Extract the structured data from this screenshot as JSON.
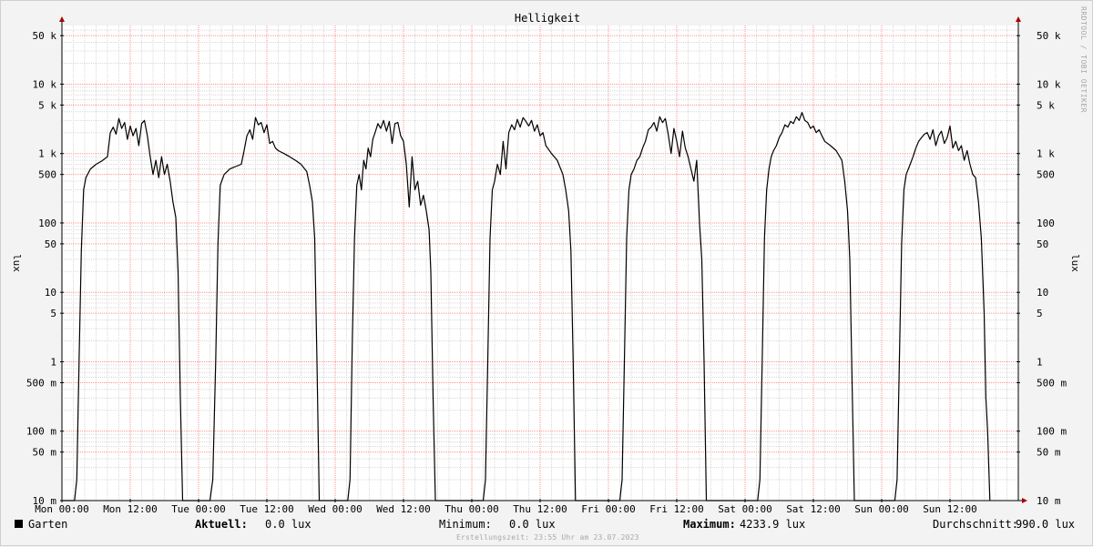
{
  "chart_data": {
    "type": "line",
    "title": "Helligkeit",
    "ylabel": "lux",
    "ylabel_right": "lux",
    "yscale": "log",
    "ylim": [
      0.01,
      70000
    ],
    "y_ticks": [
      {
        "value": 50000,
        "label": "50 k"
      },
      {
        "value": 10000,
        "label": "10 k"
      },
      {
        "value": 5000,
        "label": "5 k"
      },
      {
        "value": 1000,
        "label": "1 k"
      },
      {
        "value": 500,
        "label": "500"
      },
      {
        "value": 100,
        "label": "100"
      },
      {
        "value": 50,
        "label": "50"
      },
      {
        "value": 10,
        "label": "10"
      },
      {
        "value": 5,
        "label": "5"
      },
      {
        "value": 1,
        "label": "1"
      },
      {
        "value": 0.5,
        "label": "500 m"
      },
      {
        "value": 0.1,
        "label": "100 m"
      },
      {
        "value": 0.05,
        "label": "50 m"
      },
      {
        "value": 0.01,
        "label": "10 m"
      }
    ],
    "x_ticks": [
      "Mon 00:00",
      "Mon 12:00",
      "Tue 00:00",
      "Tue 12:00",
      "Wed 00:00",
      "Wed 12:00",
      "Thu 00:00",
      "Thu 12:00",
      "Fri 00:00",
      "Fri 12:00",
      "Sat 00:00",
      "Sat 12:00",
      "Sun 00:00",
      "Sun 12:00"
    ],
    "x_unit": "hours since Mon 00:00",
    "xlim": [
      0,
      168
    ],
    "grid": true,
    "series": [
      {
        "name": "Garten",
        "color": "#000000",
        "points": [
          [
            0,
            0.01
          ],
          [
            2.2,
            0.01
          ],
          [
            2.6,
            0.02
          ],
          [
            3.0,
            1
          ],
          [
            3.4,
            40
          ],
          [
            3.8,
            300
          ],
          [
            4.2,
            450
          ],
          [
            5.0,
            600
          ],
          [
            6.0,
            700
          ],
          [
            7.0,
            780
          ],
          [
            8.0,
            900
          ],
          [
            8.5,
            2000
          ],
          [
            9.0,
            2400
          ],
          [
            9.5,
            1900
          ],
          [
            10.0,
            3200
          ],
          [
            10.5,
            2300
          ],
          [
            11.0,
            2800
          ],
          [
            11.5,
            1600
          ],
          [
            12.0,
            2500
          ],
          [
            12.5,
            1800
          ],
          [
            13.0,
            2300
          ],
          [
            13.5,
            1300
          ],
          [
            14.0,
            2700
          ],
          [
            14.5,
            3000
          ],
          [
            15.0,
            1800
          ],
          [
            15.5,
            900
          ],
          [
            16.0,
            500
          ],
          [
            16.5,
            800
          ],
          [
            17.0,
            450
          ],
          [
            17.5,
            900
          ],
          [
            18.0,
            500
          ],
          [
            18.5,
            700
          ],
          [
            19.0,
            400
          ],
          [
            19.5,
            200
          ],
          [
            20.0,
            120
          ],
          [
            20.4,
            20
          ],
          [
            20.8,
            0.3
          ],
          [
            21.2,
            0.01
          ],
          [
            24,
            0.01
          ],
          [
            26.0,
            0.01
          ],
          [
            26.5,
            0.02
          ],
          [
            27.0,
            1
          ],
          [
            27.4,
            50
          ],
          [
            27.8,
            350
          ],
          [
            28.5,
            500
          ],
          [
            29.5,
            600
          ],
          [
            30.5,
            650
          ],
          [
            31.5,
            700
          ],
          [
            32.0,
            1100
          ],
          [
            32.5,
            1800
          ],
          [
            33.0,
            2200
          ],
          [
            33.5,
            1600
          ],
          [
            34.0,
            3300
          ],
          [
            34.5,
            2600
          ],
          [
            35.0,
            2800
          ],
          [
            35.5,
            2000
          ],
          [
            36.0,
            2600
          ],
          [
            36.5,
            1400
          ],
          [
            37.0,
            1500
          ],
          [
            37.5,
            1200
          ],
          [
            38.0,
            1100
          ],
          [
            39.0,
            1000
          ],
          [
            40.0,
            900
          ],
          [
            41.0,
            800
          ],
          [
            42.0,
            700
          ],
          [
            43.0,
            550
          ],
          [
            43.5,
            350
          ],
          [
            44.0,
            200
          ],
          [
            44.4,
            60
          ],
          [
            44.8,
            1
          ],
          [
            45.2,
            0.01
          ],
          [
            48,
            0.01
          ],
          [
            50.2,
            0.01
          ],
          [
            50.6,
            0.02
          ],
          [
            51.0,
            2
          ],
          [
            51.4,
            60
          ],
          [
            51.8,
            350
          ],
          [
            52.2,
            500
          ],
          [
            52.6,
            300
          ],
          [
            53.0,
            800
          ],
          [
            53.4,
            600
          ],
          [
            53.8,
            1200
          ],
          [
            54.2,
            900
          ],
          [
            54.6,
            1600
          ],
          [
            55.0,
            2000
          ],
          [
            55.5,
            2700
          ],
          [
            56.0,
            2300
          ],
          [
            56.5,
            3000
          ],
          [
            57.0,
            2100
          ],
          [
            57.5,
            2900
          ],
          [
            58.0,
            1400
          ],
          [
            58.5,
            2700
          ],
          [
            59.0,
            2800
          ],
          [
            59.5,
            1800
          ],
          [
            60.0,
            1500
          ],
          [
            60.5,
            700
          ],
          [
            61.0,
            170
          ],
          [
            61.5,
            900
          ],
          [
            62.0,
            300
          ],
          [
            62.5,
            400
          ],
          [
            63.0,
            180
          ],
          [
            63.5,
            250
          ],
          [
            64.0,
            150
          ],
          [
            64.5,
            80
          ],
          [
            64.8,
            20
          ],
          [
            65.2,
            0.3
          ],
          [
            65.6,
            0.01
          ],
          [
            72,
            0.01
          ],
          [
            74.0,
            0.01
          ],
          [
            74.4,
            0.02
          ],
          [
            74.8,
            1
          ],
          [
            75.2,
            60
          ],
          [
            75.6,
            300
          ],
          [
            76.0,
            400
          ],
          [
            76.5,
            700
          ],
          [
            77.0,
            500
          ],
          [
            77.5,
            1500
          ],
          [
            78.0,
            600
          ],
          [
            78.5,
            2000
          ],
          [
            79.0,
            2600
          ],
          [
            79.5,
            2200
          ],
          [
            80.0,
            3100
          ],
          [
            80.5,
            2400
          ],
          [
            81.0,
            3300
          ],
          [
            81.5,
            2900
          ],
          [
            82.0,
            2500
          ],
          [
            82.5,
            3000
          ],
          [
            83.0,
            2100
          ],
          [
            83.5,
            2600
          ],
          [
            84.0,
            1800
          ],
          [
            84.5,
            2000
          ],
          [
            85.0,
            1300
          ],
          [
            86.0,
            1000
          ],
          [
            87.0,
            800
          ],
          [
            88.0,
            500
          ],
          [
            88.5,
            300
          ],
          [
            89.0,
            150
          ],
          [
            89.4,
            40
          ],
          [
            89.8,
            1
          ],
          [
            90.2,
            0.01
          ],
          [
            96,
            0.01
          ],
          [
            98.0,
            0.01
          ],
          [
            98.4,
            0.02
          ],
          [
            98.8,
            1
          ],
          [
            99.2,
            60
          ],
          [
            99.6,
            300
          ],
          [
            100.0,
            500
          ],
          [
            100.5,
            600
          ],
          [
            101.0,
            800
          ],
          [
            101.5,
            900
          ],
          [
            102.0,
            1200
          ],
          [
            102.5,
            1500
          ],
          [
            103.0,
            2200
          ],
          [
            103.5,
            2400
          ],
          [
            104.0,
            2800
          ],
          [
            104.5,
            2100
          ],
          [
            105.0,
            3400
          ],
          [
            105.5,
            2800
          ],
          [
            106.0,
            3200
          ],
          [
            106.5,
            1900
          ],
          [
            107.0,
            1000
          ],
          [
            107.5,
            2300
          ],
          [
            108.0,
            1500
          ],
          [
            108.5,
            900
          ],
          [
            109.0,
            2100
          ],
          [
            109.5,
            1200
          ],
          [
            110.0,
            900
          ],
          [
            110.5,
            600
          ],
          [
            111.0,
            400
          ],
          [
            111.5,
            800
          ],
          [
            112.0,
            100
          ],
          [
            112.4,
            30
          ],
          [
            112.8,
            1
          ],
          [
            113.2,
            0.01
          ],
          [
            120,
            0.01
          ],
          [
            122.2,
            0.01
          ],
          [
            122.6,
            0.02
          ],
          [
            123.0,
            1
          ],
          [
            123.4,
            60
          ],
          [
            123.8,
            300
          ],
          [
            124.2,
            600
          ],
          [
            124.6,
            900
          ],
          [
            125.0,
            1100
          ],
          [
            125.5,
            1300
          ],
          [
            126.0,
            1700
          ],
          [
            126.5,
            2000
          ],
          [
            127.0,
            2600
          ],
          [
            127.5,
            2400
          ],
          [
            128.0,
            2900
          ],
          [
            128.5,
            2700
          ],
          [
            129.0,
            3400
          ],
          [
            129.5,
            3000
          ],
          [
            130.0,
            3900
          ],
          [
            130.5,
            3000
          ],
          [
            131.0,
            2800
          ],
          [
            131.5,
            2300
          ],
          [
            132.0,
            2500
          ],
          [
            132.5,
            2000
          ],
          [
            133.0,
            2200
          ],
          [
            133.5,
            1800
          ],
          [
            134.0,
            1500
          ],
          [
            135.0,
            1300
          ],
          [
            136.0,
            1100
          ],
          [
            137.0,
            800
          ],
          [
            137.5,
            400
          ],
          [
            138.0,
            150
          ],
          [
            138.4,
            30
          ],
          [
            138.8,
            0.5
          ],
          [
            139.2,
            0.01
          ],
          [
            144,
            0.01
          ],
          [
            146.3,
            0.01
          ],
          [
            146.7,
            0.02
          ],
          [
            147.1,
            1
          ],
          [
            147.5,
            50
          ],
          [
            147.9,
            300
          ],
          [
            148.3,
            500
          ],
          [
            149.0,
            700
          ],
          [
            149.5,
            900
          ],
          [
            150.0,
            1200
          ],
          [
            150.5,
            1500
          ],
          [
            151.0,
            1700
          ],
          [
            151.5,
            1900
          ],
          [
            152.0,
            2000
          ],
          [
            152.5,
            1600
          ],
          [
            153.0,
            2200
          ],
          [
            153.5,
            1300
          ],
          [
            154.0,
            1800
          ],
          [
            154.5,
            2100
          ],
          [
            155.0,
            1400
          ],
          [
            155.5,
            1700
          ],
          [
            156.0,
            2500
          ],
          [
            156.5,
            1200
          ],
          [
            157.0,
            1500
          ],
          [
            157.5,
            1100
          ],
          [
            158.0,
            1300
          ],
          [
            158.5,
            800
          ],
          [
            159.0,
            1100
          ],
          [
            159.5,
            700
          ],
          [
            160.0,
            500
          ],
          [
            160.5,
            450
          ],
          [
            161.0,
            200
          ],
          [
            161.5,
            60
          ],
          [
            162.0,
            5
          ],
          [
            162.3,
            0.3
          ],
          [
            162.6,
            0.1
          ],
          [
            163.0,
            0.01
          ]
        ]
      }
    ]
  },
  "legend": {
    "series_name": "Garten",
    "current_label": "Aktuell:",
    "current_value": "0.0 lux",
    "minimum_label": "Minimum:",
    "minimum_value": "0.0 lux",
    "maximum_label": "Maximum:",
    "maximum_value": "4233.9 lux",
    "average_label": "Durchschnitt:",
    "average_value": "990.0 lux"
  },
  "footer": {
    "credit": "Erstellungszeit: 23:55 Uhr am 23.07.2023"
  },
  "watermark": "RRDTOOL / TOBI OETIKER",
  "colors": {
    "background": "#f3f3f3",
    "canvas": "#ffffff",
    "major_grid": "#ff9090",
    "minor_grid": "#d8d8d8",
    "axis": "#000000",
    "arrow": "#aa0000",
    "line": "#000000"
  }
}
